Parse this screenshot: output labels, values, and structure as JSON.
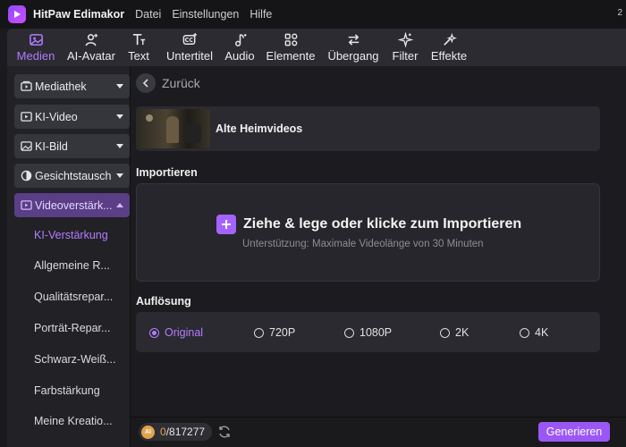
{
  "app": {
    "name": "HitPaw Edimakor",
    "version_tag": "2"
  },
  "menu": [
    "Datei",
    "Einstellungen",
    "Hilfe"
  ],
  "toolbar": {
    "items": [
      {
        "label": "Medien",
        "icon": "media-icon",
        "active": true
      },
      {
        "label": "AI-Avatar",
        "icon": "avatar-icon"
      },
      {
        "label": "Text",
        "icon": "text-icon"
      },
      {
        "label": "Untertitel",
        "icon": "subtitle-icon"
      },
      {
        "label": "Audio",
        "icon": "audio-icon"
      },
      {
        "label": "Elemente",
        "icon": "elements-icon"
      },
      {
        "label": "Übergang",
        "icon": "transition-icon"
      },
      {
        "label": "Filter",
        "icon": "filter-icon"
      },
      {
        "label": "Effekte",
        "icon": "effects-icon"
      }
    ],
    "accent": "#b37bff"
  },
  "sidebar": {
    "groups": [
      {
        "label": "Mediathek",
        "icon": "library-icon"
      },
      {
        "label": "KI-Video",
        "icon": "ai-video-icon"
      },
      {
        "label": "KI-Bild",
        "icon": "ai-image-icon"
      },
      {
        "label": "Gesichtstausch",
        "icon": "face-swap-icon"
      },
      {
        "label": "Videoverstärk...",
        "icon": "video-enhance-icon",
        "expanded": true
      }
    ],
    "sub_items": [
      {
        "label": "KI-Verstärkung",
        "active": true
      },
      {
        "label": "Allgemeine R..."
      },
      {
        "label": "Qualitätsrepar..."
      },
      {
        "label": "Porträt-Repar..."
      },
      {
        "label": "Schwarz-Weiß..."
      },
      {
        "label": "Farbstärkung"
      },
      {
        "label": "Meine Kreatio..."
      }
    ]
  },
  "main": {
    "back_label": "Zurück",
    "feature": {
      "title": "Alte Heimvideos"
    },
    "import": {
      "heading": "Importieren",
      "title": "Ziehe & lege oder klicke zum Importieren",
      "subtitle": "Unterstützung: Maximale Videolänge von 30 Minuten"
    },
    "resolution": {
      "heading": "Auflösung",
      "options": [
        "Original",
        "720P",
        "1080P",
        "2K",
        "4K"
      ],
      "selected": "Original"
    }
  },
  "footer": {
    "credits_used": "0",
    "credits_total": "/817277",
    "coin_label": "AI",
    "generate_label": "Generieren"
  }
}
